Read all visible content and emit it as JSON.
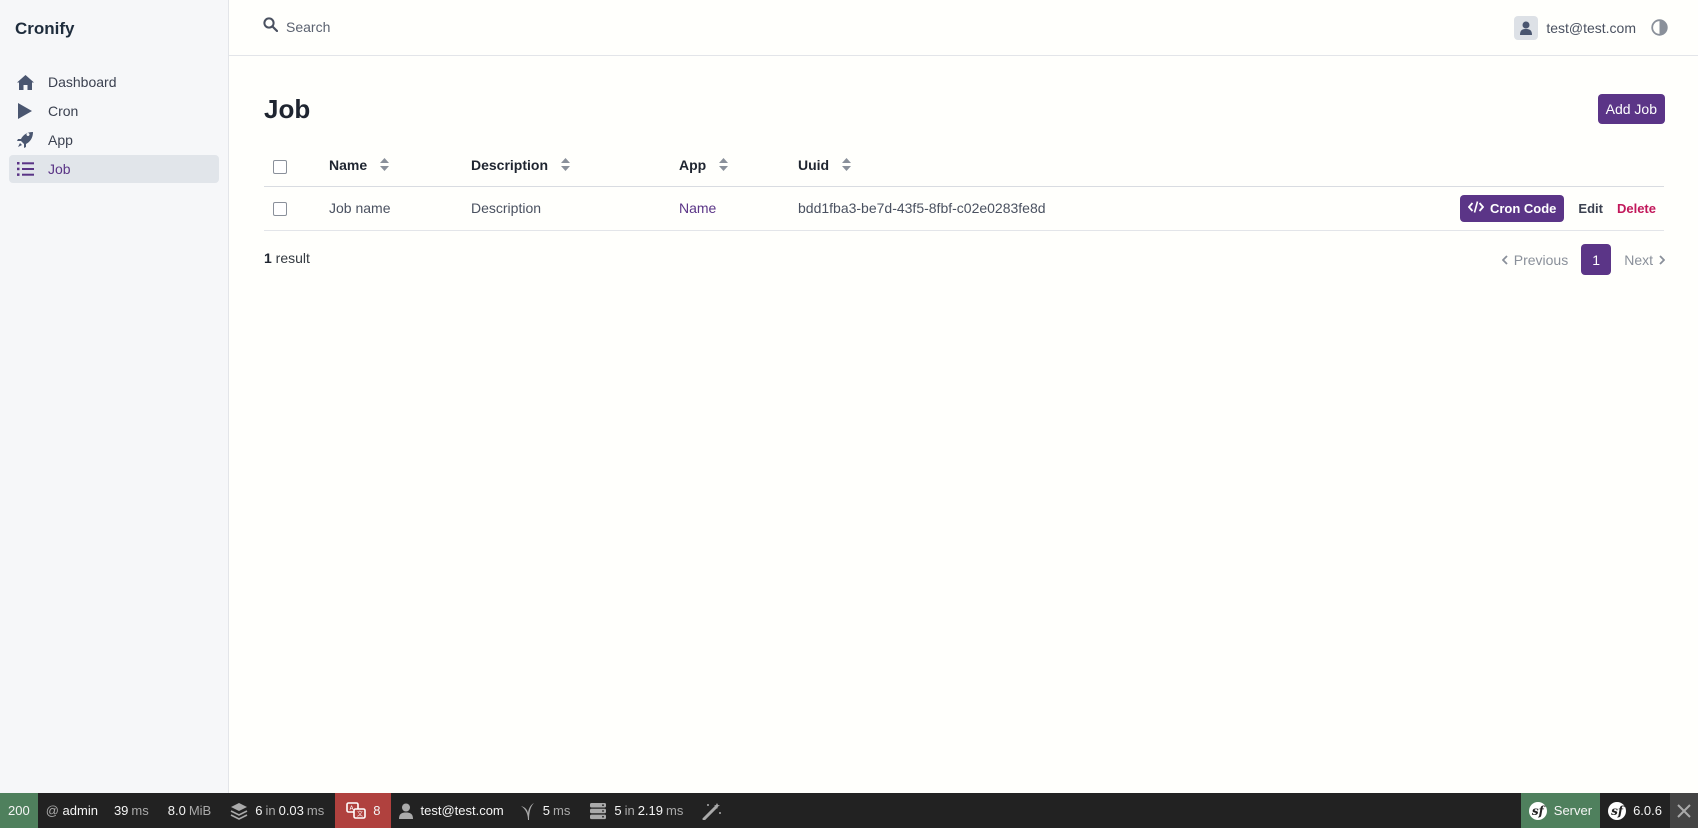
{
  "app": {
    "brand": "Cronify"
  },
  "sidebar": {
    "items": [
      {
        "label": "Dashboard",
        "icon": "home-icon",
        "active": false
      },
      {
        "label": "Cron",
        "icon": "play-icon",
        "active": false
      },
      {
        "label": "App",
        "icon": "rocket-icon",
        "active": false
      },
      {
        "label": "Job",
        "icon": "list-icon",
        "active": true
      }
    ]
  },
  "header": {
    "search_placeholder": "Search",
    "user_email": "test@test.com"
  },
  "page": {
    "title": "Job",
    "add_button": "Add Job"
  },
  "table": {
    "columns": [
      "Name",
      "Description",
      "App",
      "Uuid"
    ],
    "rows": [
      {
        "name": "Job name",
        "description": "Description",
        "app": "Name",
        "uuid": "bdd1fba3-be7d-43f5-8fbf-c02e0283fe8d",
        "actions": {
          "cron_code": "Cron Code",
          "edit": "Edit",
          "delete": "Delete"
        }
      }
    ]
  },
  "footer": {
    "result_count": "1",
    "result_label": " result",
    "prev": "Previous",
    "current_page": "1",
    "next": "Next"
  },
  "debug_toolbar": {
    "status": "200",
    "route_prefix": "@",
    "route": "admin",
    "time_value": "39",
    "time_unit": "ms",
    "memory_value": "8.0",
    "memory_unit": "MiB",
    "cache_count": "6",
    "cache_in": "in",
    "cache_time": "0.03",
    "cache_unit": "ms",
    "errors": "8",
    "user": "test@test.com",
    "twig_time": "5",
    "twig_unit": "ms",
    "db_count": "5",
    "db_in": "in",
    "db_time": "2.19",
    "db_unit": "ms",
    "server": "Server",
    "version": "6.0.6"
  },
  "colors": {
    "accent": "#5b3587",
    "danger": "#c2185b",
    "toolbar_bg": "#222222",
    "toolbar_ok": "#4f805d",
    "toolbar_err": "#b0413e"
  }
}
